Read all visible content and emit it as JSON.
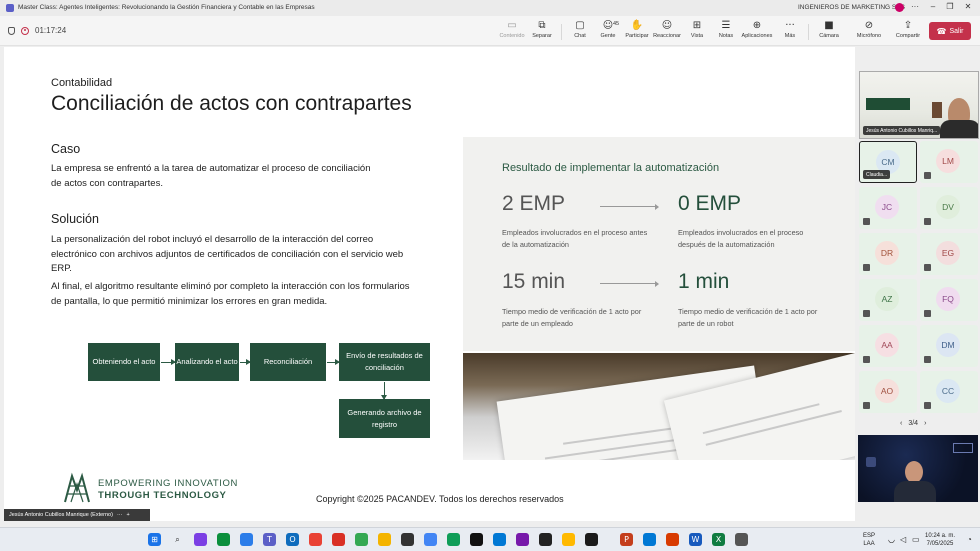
{
  "window": {
    "title": "Master Class: Agentes Inteligentes: Revolucionando la Gestión Financiera y Contable en las Empresas",
    "org": "INGENIEROS DE MARKETING SAS"
  },
  "toolbar": {
    "timer": "01:17:24",
    "buttons": {
      "content": "Contenido",
      "separate": "Separar",
      "chat": "Chat",
      "people": "Gente",
      "people_count": "45",
      "participate": "Participar",
      "react": "Reaccionar",
      "view": "Vista",
      "notes": "Notas",
      "apps": "Aplicaciones",
      "more": "Más",
      "camera": "Cámara",
      "mic": "Micrófono",
      "share": "Compartir",
      "leave": "Salir"
    }
  },
  "slide": {
    "category": "Contabilidad",
    "title": "Conciliación de actos con contrapartes",
    "case_heading": "Caso",
    "case_text": "La empresa se enfrentó a la tarea de automatizar el proceso de conciliación de actos con contrapartes.",
    "solution_heading": "Solución",
    "solution_text_1": "La personalización del robot incluyó el desarrollo de la interacción del correo electrónico con archivos adjuntos de certificados de conciliación con el servicio web ERP.",
    "solution_text_2": "Al final, el algoritmo resultante eliminó por completo la interacción con los formularios de pantalla, lo que permitió minimizar los errores en gran medida.",
    "flow": {
      "step1": "Obteniendo el acto",
      "step2": "Analizando el acto",
      "step3": "Reconciliación",
      "step4": "Envío de resultados de conciliación",
      "step5": "Generando archivo de registro"
    },
    "results": {
      "title": "Resultado de implementar la automatización",
      "before_emp": "2 EMP",
      "after_emp": "0 EMP",
      "before_emp_note": "Empleados involucrados en el proceso antes de la automatización",
      "after_emp_note": "Empleados involucrados en el proceso después de la automatización",
      "before_time": "15 min",
      "after_time": "1 min",
      "before_time_note": "Tiempo medio de verificación de 1 acto por parte de un empleado",
      "after_time_note": "Tiempo medio de verificación de 1 acto por parte de un robot"
    },
    "logo_line1": "EMPOWERING INNOVATION",
    "logo_line2": "THROUGH TECHNOLOGY",
    "copyright": "Copyright ©2025 PACANDEV. Todos los derechos reservados"
  },
  "presenter_label": "Jesús Antonio Cubillos Manrique (Externo)",
  "participants": {
    "video_name": "Jesús Antonio Cubillos Manriq...",
    "selected_name": "Claudia...",
    "tiles": [
      {
        "initials": "CM",
        "bg": "#dbe8f3",
        "fg": "#4a6b8a"
      },
      {
        "initials": "LM",
        "bg": "#f6dede",
        "fg": "#a04848"
      },
      {
        "initials": "JC",
        "bg": "#f0def0",
        "fg": "#8a4a8a"
      },
      {
        "initials": "DV",
        "bg": "#e0eedc",
        "fg": "#4a7a48"
      },
      {
        "initials": "DR",
        "bg": "#f6e0da",
        "fg": "#a05038"
      },
      {
        "initials": "EG",
        "bg": "#f3dede",
        "fg": "#a04848"
      },
      {
        "initials": "AZ",
        "bg": "#dfeedc",
        "fg": "#3f7448"
      },
      {
        "initials": "FQ",
        "bg": "#f0dcef",
        "fg": "#8a4a8a"
      },
      {
        "initials": "AA",
        "bg": "#f6dfe3",
        "fg": "#a04858"
      },
      {
        "initials": "DM",
        "bg": "#dce6f3",
        "fg": "#3f5f8a"
      },
      {
        "initials": "AO",
        "bg": "#f6e0dc",
        "fg": "#a05040"
      },
      {
        "initials": "CC",
        "bg": "#dbe8f3",
        "fg": "#4a6b8a"
      }
    ],
    "page": "3/4"
  },
  "taskbar": {
    "lang1": "ESP",
    "lang2": "LAA",
    "time": "10:24 a. m.",
    "date": "7/05/2025"
  }
}
